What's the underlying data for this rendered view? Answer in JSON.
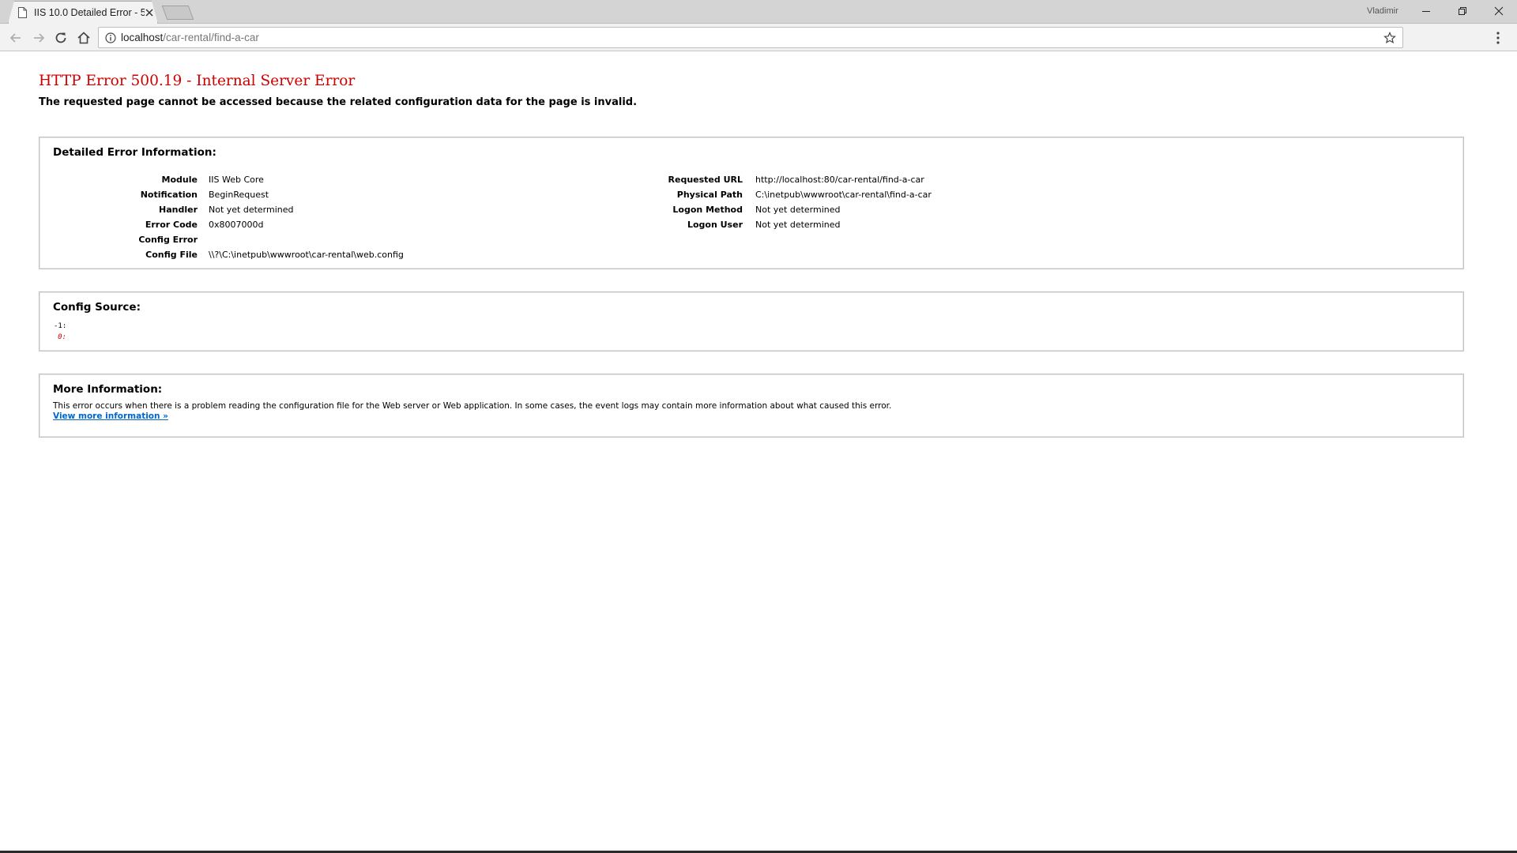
{
  "browser": {
    "tab_title": "IIS 10.0 Detailed Error - 5",
    "user": "Vladimir",
    "url_host": "localhost",
    "url_path": "/car-rental/find-a-car"
  },
  "page": {
    "title": "HTTP Error 500.19 - Internal Server Error",
    "subtitle": "The requested page cannot be accessed because the related configuration data for the page is invalid.",
    "detailed": {
      "heading": "Detailed Error Information:",
      "left": [
        {
          "label": "Module",
          "value": "IIS Web Core"
        },
        {
          "label": "Notification",
          "value": "BeginRequest"
        },
        {
          "label": "Handler",
          "value": "Not yet determined"
        },
        {
          "label": "Error Code",
          "value": "0x8007000d"
        },
        {
          "label": "Config Error",
          "value": ""
        },
        {
          "label": "Config File",
          "value": "\\\\?\\C:\\inetpub\\wwwroot\\car-rental\\web.config"
        }
      ],
      "right": [
        {
          "label": "Requested URL",
          "value": "http://localhost:80/car-rental/find-a-car"
        },
        {
          "label": "Physical Path",
          "value": "C:\\inetpub\\wwwroot\\car-rental\\find-a-car"
        },
        {
          "label": "Logon Method",
          "value": "Not yet determined"
        },
        {
          "label": "Logon User",
          "value": "Not yet determined"
        }
      ]
    },
    "config_source": {
      "heading": "Config Source:",
      "lines": [
        "-1:",
        "0:"
      ]
    },
    "more_info": {
      "heading": "More Information:",
      "text": "This error occurs when there is a problem reading the configuration file for the Web server or Web application. In some cases, the event logs may contain more information about what caused this error.",
      "link": "View more information »"
    }
  }
}
